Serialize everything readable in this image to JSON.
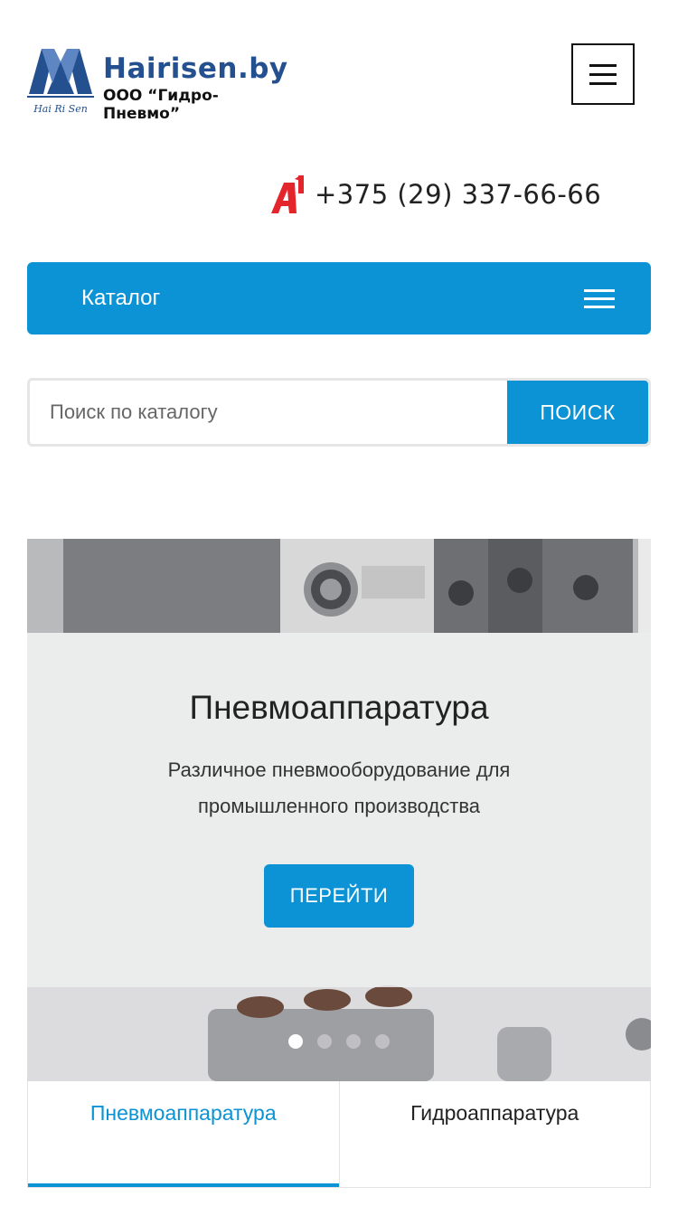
{
  "header": {
    "logo_title": "Hairisen.by",
    "logo_subtitle": "ООО “Гидро-Пневмо”",
    "logo_mark_text": "Hai Ri Sen",
    "menu_icon": "hamburger-icon"
  },
  "contact": {
    "operator_logo": "A1",
    "phone": "+375 (29) 337-66-66"
  },
  "catalog": {
    "label": "Каталог",
    "icon": "hamburger-icon"
  },
  "search": {
    "placeholder": "Поиск по каталогу",
    "value": "",
    "button_label": "ПОИСК"
  },
  "slider": {
    "title": "Пневмоаппаратура",
    "description": "Различное пневмооборудование для промышленного производства",
    "button_label": "ПЕРЕЙТИ",
    "slide_count": 4,
    "active_index": 0
  },
  "tabs": [
    {
      "label": "Пневмоаппаратура",
      "active": true
    },
    {
      "label": "Гидроаппаратура",
      "active": false
    }
  ],
  "colors": {
    "accent": "#0b93d5",
    "logo_blue": "#24508f",
    "a1_red": "#e3262b"
  }
}
